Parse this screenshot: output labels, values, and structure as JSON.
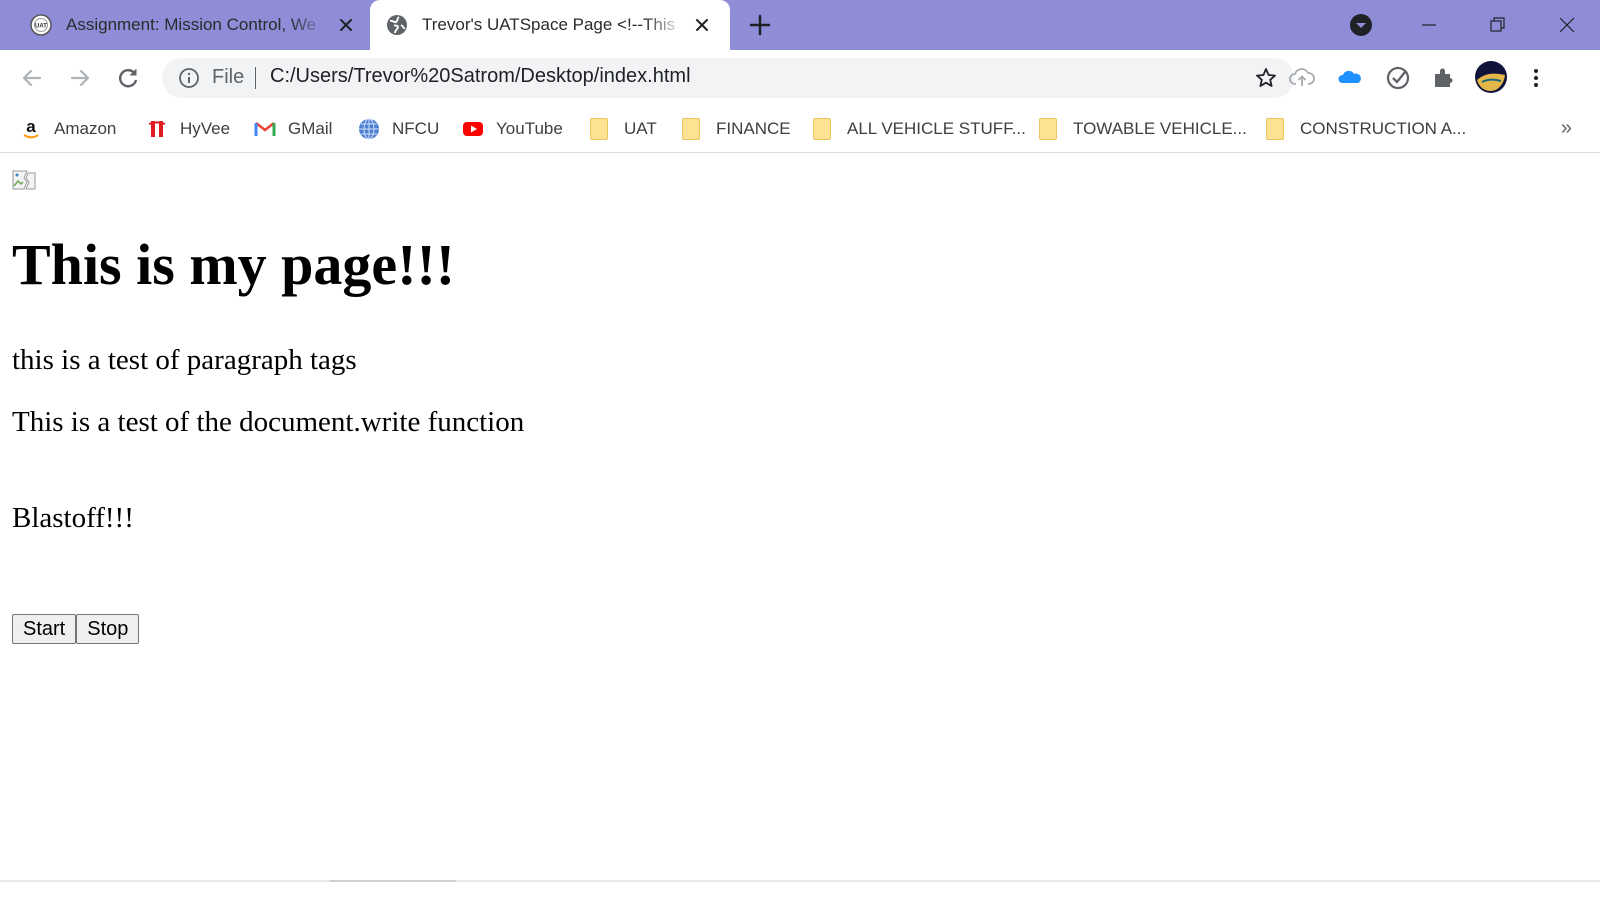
{
  "browser": {
    "tabs": [
      {
        "title": "Assignment: Mission Control, We",
        "active": false,
        "icon": "uat-logo-icon"
      },
      {
        "title": "Trevor's UATSpace Page <!--This",
        "active": true,
        "icon": "globe-icon"
      }
    ],
    "address_bar": {
      "scheme_label": "File",
      "url": "C:/Users/Trevor%20Satrom/Desktop/index.html"
    },
    "bookmarks": [
      {
        "label": "Amazon",
        "icon": "amazon-icon"
      },
      {
        "label": "HyVee",
        "icon": "hyvee-icon"
      },
      {
        "label": "GMail",
        "icon": "gmail-icon"
      },
      {
        "label": "NFCU",
        "icon": "globe-icon"
      },
      {
        "label": "YouTube",
        "icon": "youtube-icon"
      },
      {
        "label": "UAT",
        "icon": "folder-icon"
      },
      {
        "label": "FINANCE",
        "icon": "folder-icon"
      },
      {
        "label": "ALL VEHICLE STUFF...",
        "icon": "folder-icon"
      },
      {
        "label": "TOWABLE VEHICLE...",
        "icon": "folder-icon"
      },
      {
        "label": "CONSTRUCTION A...",
        "icon": "folder-icon"
      }
    ],
    "bookmarks_overflow": "»",
    "colors": {
      "tab_strip": "#8f8cd8",
      "active_tab": "#ffffff",
      "omnibox": "#f1f3f4"
    }
  },
  "page": {
    "heading": "This is my page!!!",
    "paragraphs": [
      "this is a test of paragraph tags",
      "This is a test of the document.write function",
      "Blastoff!!!"
    ],
    "buttons": {
      "start": "Start",
      "stop": "Stop"
    }
  }
}
